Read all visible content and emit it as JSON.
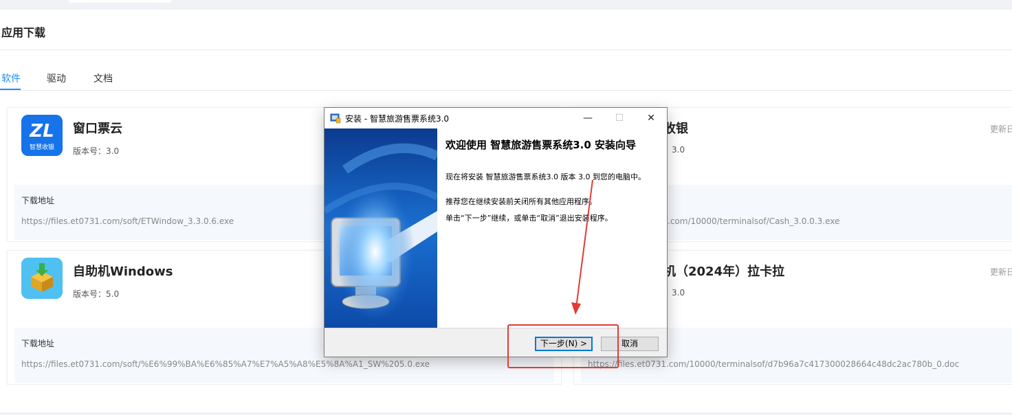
{
  "page": {
    "title": "应用下载"
  },
  "tabs": [
    {
      "label": "软件",
      "active": true
    },
    {
      "label": "驱动",
      "active": false
    },
    {
      "label": "文档",
      "active": false
    }
  ],
  "cards": [
    {
      "name": "窗口票云",
      "version_label": "版本号：3.0",
      "update": "",
      "dl_label": "下载地址",
      "url": "https://files.et0731.com/soft/ETWindow_3.3.0.6.exe",
      "icon": "zhihui-shouyin-logo",
      "icon_text": "智慧收银"
    },
    {
      "name": "收银",
      "version_label": "3.0",
      "update": "更新日",
      "dl_label": "",
      "url": ".com/10000/terminalsof/Cash_3.0.0.3.exe",
      "icon": ""
    },
    {
      "name": "自助机Windows",
      "version_label": "版本号：5.0",
      "update": "",
      "dl_label": "下载地址",
      "url": "https://files.et0731.com/soft/%E6%99%BA%E6%85%A7%E7%A5%A8%E5%8A%A1_SW%205.0.exe",
      "icon": "package-box-icon"
    },
    {
      "name": "机（2024年）拉卡拉",
      "version_label": "3.0",
      "update": "更新日",
      "dl_label": "",
      "url": "https://files.et0731.com/10000/terminalsof/d7b96a7c417300028664c48dc2ac780b_0.doc",
      "icon": ""
    }
  ],
  "dialog": {
    "title": "安装 - 智慧旅游售票系统3.0",
    "minimize": "—",
    "maximize": "☐",
    "close": "✕",
    "heading": "欢迎使用 智慧旅游售票系统3.0 安装向导",
    "p1": "现在将安装 智慧旅游售票系统3.0 版本 3.0 到您的电脑中。",
    "p2": "推荐您在继续安装前关闭所有其他应用程序。",
    "p3": "单击“下一步”继续，或单击“取消”退出安装程序。",
    "next_label": "下一步(N) >",
    "cancel_label": "取消"
  },
  "annotation": {
    "color": "#e53935"
  }
}
